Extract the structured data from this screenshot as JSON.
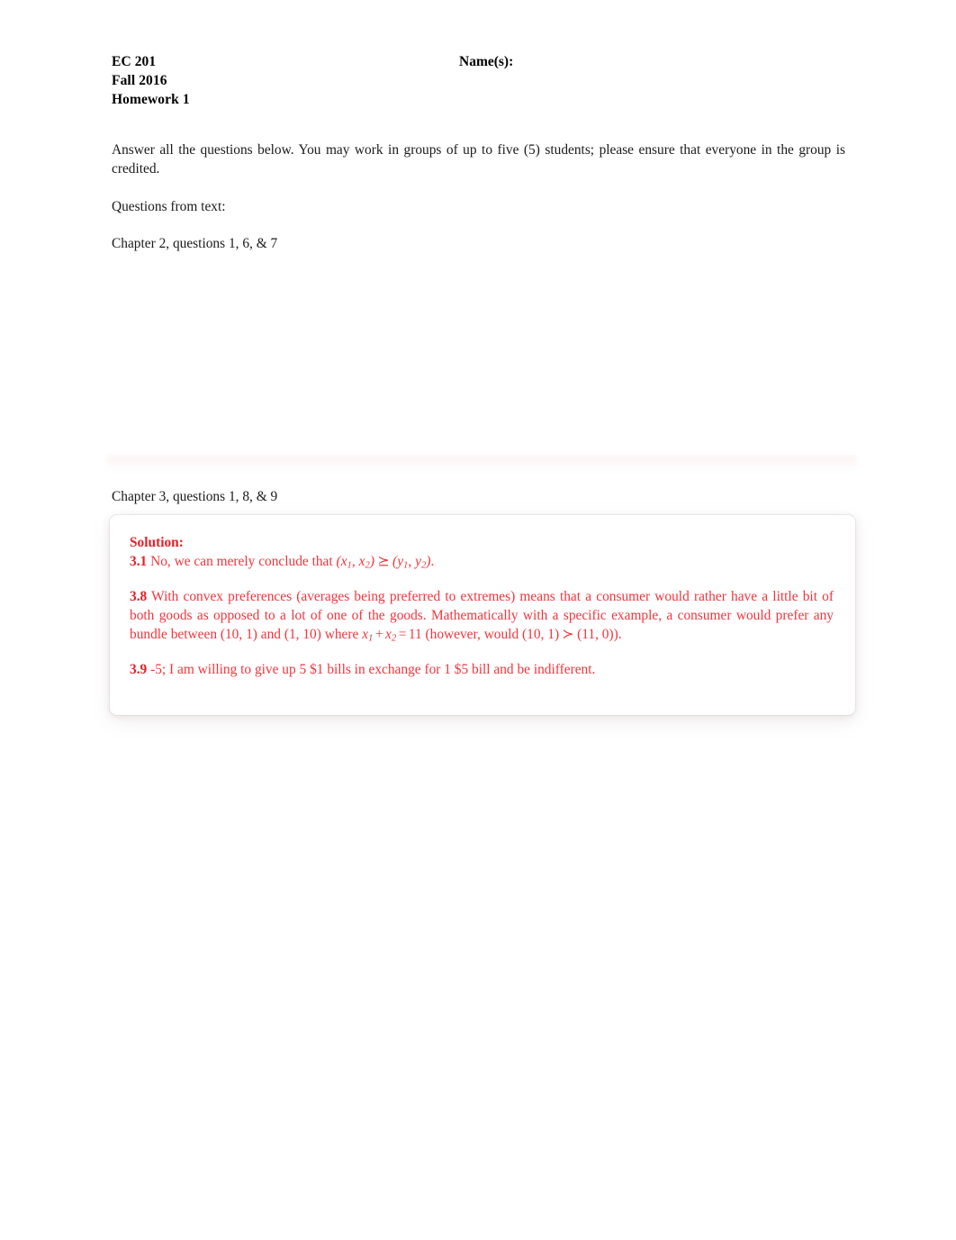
{
  "header": {
    "course": "EC 201",
    "term": "Fall 2016",
    "assignment": "Homework 1",
    "names_label": "Name(s):"
  },
  "body": {
    "intro": "Answer all the questions below.  You may work in groups of up to five (5) students; please ensure that everyone in the group is credited.",
    "questions_label": "Questions from text:",
    "chapter2": "Chapter 2, questions 1, 6, & 7",
    "chapter3": "Chapter 3, questions 1, 8, & 9"
  },
  "solution": {
    "title": "Solution:",
    "items": [
      {
        "number": "3.1",
        "text_before": "No, we can merely conclude that ",
        "math": "(x1, x2) ⪰ (y1, y2)",
        "text_after": "."
      },
      {
        "number": "3.8",
        "line1": "With convex preferences (averages being preferred to extremes) means that a consumer would rather have a little bit of both goods as opposed to a lot of one of the goods. Mathematically with a specific example, a consumer would prefer any bundle between ",
        "bundle_a": "(10, 1)",
        "mid": " and ",
        "bundle_b": "(1, 10)",
        "where_word": " where ",
        "equation": "x1 + x2 = 11",
        "tail_open": " (however, would ",
        "bundle_c": "(10, 1)",
        "strict_rel": "≻",
        "bundle_d": "(11, 0)",
        "tail_close": ")."
      },
      {
        "number": "3.9",
        "text": "-5; I am willing to give up 5 $1 bills in exchange for 1 $5 bill and be indifferent."
      }
    ]
  },
  "colors": {
    "solution_red": "#f0353c",
    "solution_red_bold": "#e42029",
    "page_background": "#ffffff",
    "body_text": "#1a1a1a"
  }
}
